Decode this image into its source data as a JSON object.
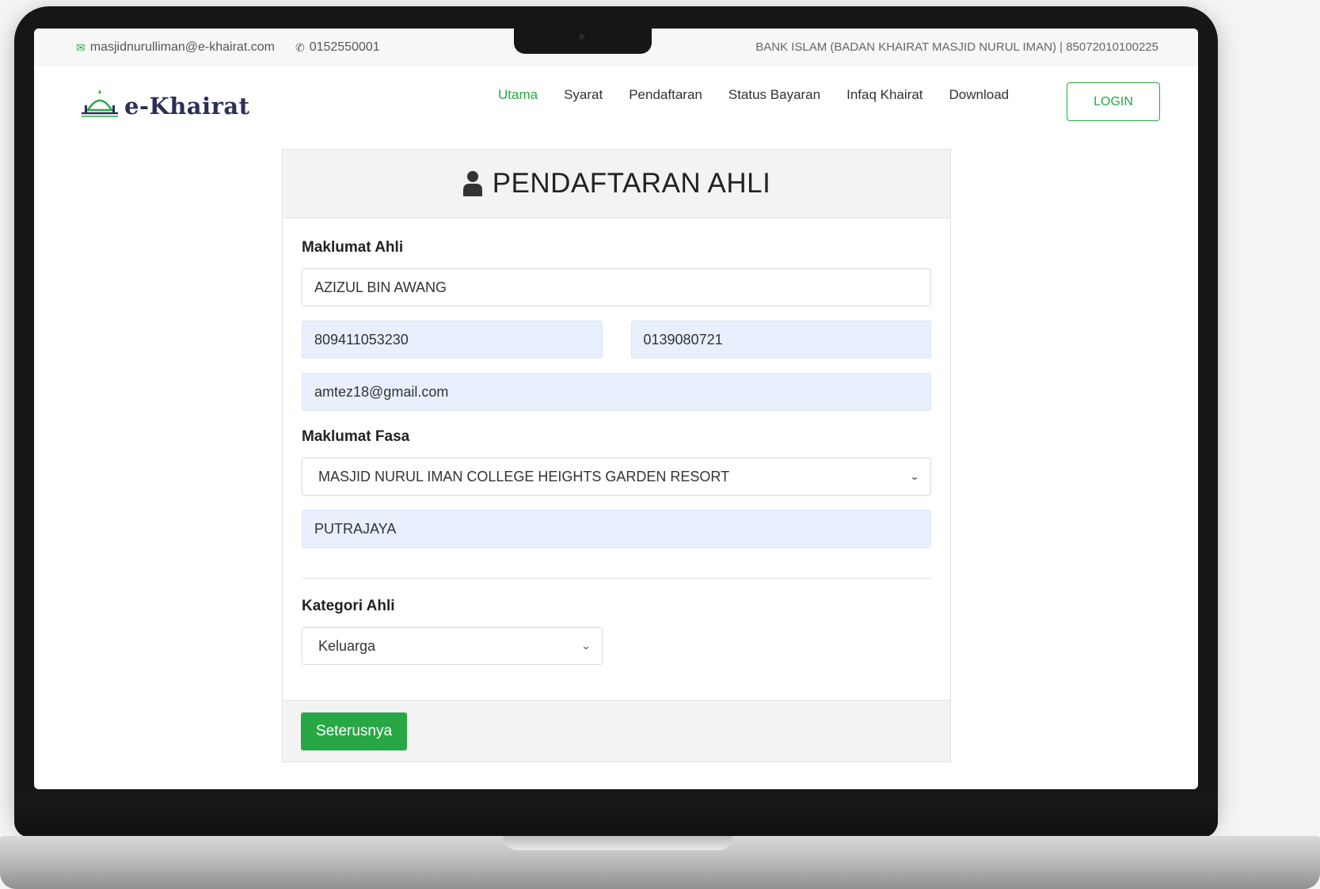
{
  "topbar": {
    "email": "masjidnurulliman@e-khairat.com",
    "phone": "0152550001",
    "bank": "BANK ISLAM (BADAN KHAIRAT MASJID NURUL IMAN) | 85072010100225"
  },
  "brand": {
    "name": "e-Khairat"
  },
  "nav": {
    "items": [
      "Utama",
      "Syarat",
      "Pendaftaran",
      "Status Bayaran",
      "Infaq Khairat",
      "Download"
    ],
    "login": "LOGIN"
  },
  "form": {
    "title": "PENDAFTARAN AHLI",
    "section_ahli": "Maklumat Ahli",
    "name": "AZIZUL BIN AWANG",
    "ic": "809411053230",
    "phone": "0139080721",
    "email": "amtez18@gmail.com",
    "section_fasa": "Maklumat Fasa",
    "fasa": "MASJID NURUL IMAN COLLEGE HEIGHTS GARDEN RESORT",
    "city": "PUTRAJAYA",
    "section_kategori": "Kategori Ahli",
    "kategori": "Keluarga",
    "next": "Seterusnya"
  },
  "colors": {
    "accent": "#28a745",
    "filled_input": "#e8f0fe"
  }
}
